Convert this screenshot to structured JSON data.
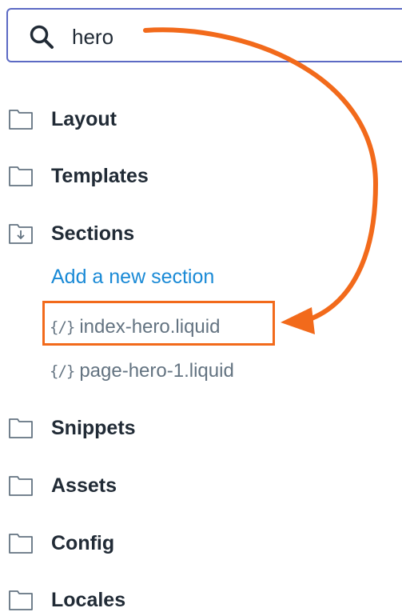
{
  "search": {
    "value": "hero",
    "icon": "search-icon"
  },
  "tree": {
    "folders": [
      {
        "label": "Layout",
        "icon": "folder-icon"
      },
      {
        "label": "Templates",
        "icon": "folder-icon"
      },
      {
        "label": "Sections",
        "icon": "folder-open-icon"
      },
      {
        "label": "Snippets",
        "icon": "folder-icon"
      },
      {
        "label": "Assets",
        "icon": "folder-icon"
      },
      {
        "label": "Config",
        "icon": "folder-icon"
      },
      {
        "label": "Locales",
        "icon": "folder-icon"
      }
    ],
    "sections": {
      "add_label": "Add a new section",
      "files": [
        {
          "icon": "{/}",
          "name": "index-hero.liquid",
          "highlighted": true
        },
        {
          "icon": "{/}",
          "name": "page-hero-1.liquid",
          "highlighted": false
        }
      ]
    }
  },
  "colors": {
    "search_border": "#5c6ac4",
    "link": "#1a8ad6",
    "annotation": "#f26a1b",
    "folder_label": "#212b36",
    "file_text": "#637381"
  }
}
